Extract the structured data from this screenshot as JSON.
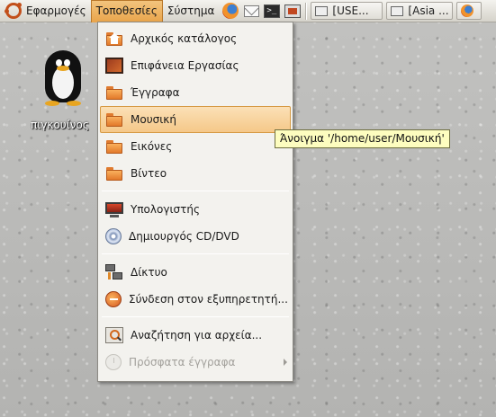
{
  "panel": {
    "menus": [
      "Εφαρμογές",
      "Τοποθεσίες",
      "Σύστημα"
    ],
    "launchers": [
      "firefox-icon",
      "mail-icon",
      "terminal-icon",
      "screenshot-icon"
    ],
    "tasks": [
      "[USE...",
      "[Asia ...",
      ""
    ],
    "accent_color": "#e9a44a"
  },
  "desktop": {
    "icon_label": "πιγκουίνος"
  },
  "menu": {
    "items": [
      {
        "label": "Αρχικός κατάλογος",
        "icon": "home-folder-icon"
      },
      {
        "label": "Επιφάνεια Εργασίας",
        "icon": "desktop-icon"
      },
      {
        "label": "Έγγραφα",
        "icon": "folder-icon"
      },
      {
        "label": "Μουσική",
        "icon": "folder-icon",
        "highlighted": true
      },
      {
        "label": "Εικόνες",
        "icon": "folder-icon"
      },
      {
        "label": "Βίντεο",
        "icon": "folder-icon"
      },
      {
        "label": "Υπολογιστής",
        "icon": "computer-icon"
      },
      {
        "label": "Δημιουργός CD/DVD",
        "icon": "cd-icon"
      },
      {
        "label": "Δίκτυο",
        "icon": "network-icon"
      },
      {
        "label": "Σύνδεση στον εξυπηρετητή...",
        "icon": "server-icon"
      },
      {
        "label": "Αναζήτηση για αρχεία...",
        "icon": "search-icon"
      },
      {
        "label": "Πρόσφατα έγγραφα",
        "icon": "recent-icon",
        "disabled": true,
        "submenu": true
      }
    ]
  },
  "tooltip": {
    "text": "Άνοιγμα '/home/user/Μουσική'"
  }
}
